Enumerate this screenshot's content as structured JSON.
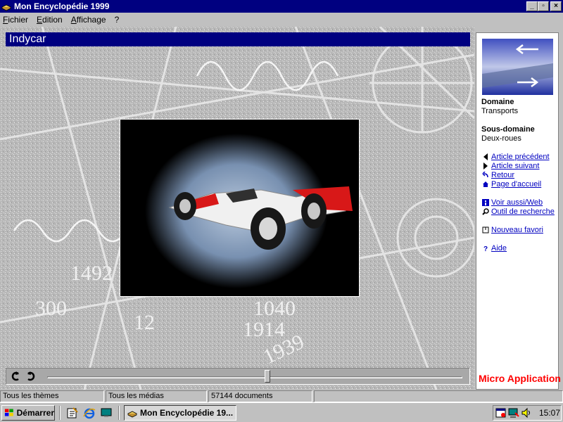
{
  "window": {
    "title": "Mon Encyclopédie 1999",
    "controls": {
      "minimize": "_",
      "maximize": "▫",
      "close": "×"
    }
  },
  "menu": [
    "Fichier",
    "Edition",
    "Affichage",
    "?"
  ],
  "article": {
    "title": "Indycar"
  },
  "sidebar": {
    "domain_label": "Domaine",
    "domain_value": "Transports",
    "subdomain_label": "Sous-domaine",
    "subdomain_value": "Deux-roues",
    "links": [
      {
        "label": "Article précédent",
        "icon": "triangle-left-icon"
      },
      {
        "label": "Article suivant",
        "icon": "triangle-right-icon"
      },
      {
        "label": "Retour",
        "icon": "back-arrow-icon"
      },
      {
        "label": "Page d'accueil",
        "icon": "home-icon"
      },
      {
        "label": "Voir aussi/Web",
        "icon": "info-icon"
      },
      {
        "label": "Outil de recherche",
        "icon": "magnifier-icon"
      },
      {
        "label": "Nouveau favori",
        "icon": "bookmark-icon"
      },
      {
        "label": "Aide",
        "icon": "question-icon"
      }
    ],
    "brand": "Micro Application",
    "colors": {
      "link": "#0000c0",
      "brand": "#ff0000",
      "title_bar": "#000080"
    }
  },
  "media_controls": {
    "slider_position": 0.53
  },
  "status": {
    "themes": "Tous les thèmes",
    "media": "Tous les médias",
    "documents": "57144 documents"
  },
  "taskbar": {
    "start": "Démarrer",
    "task": "Mon Encyclopédie 19...",
    "clock": "15:07"
  }
}
